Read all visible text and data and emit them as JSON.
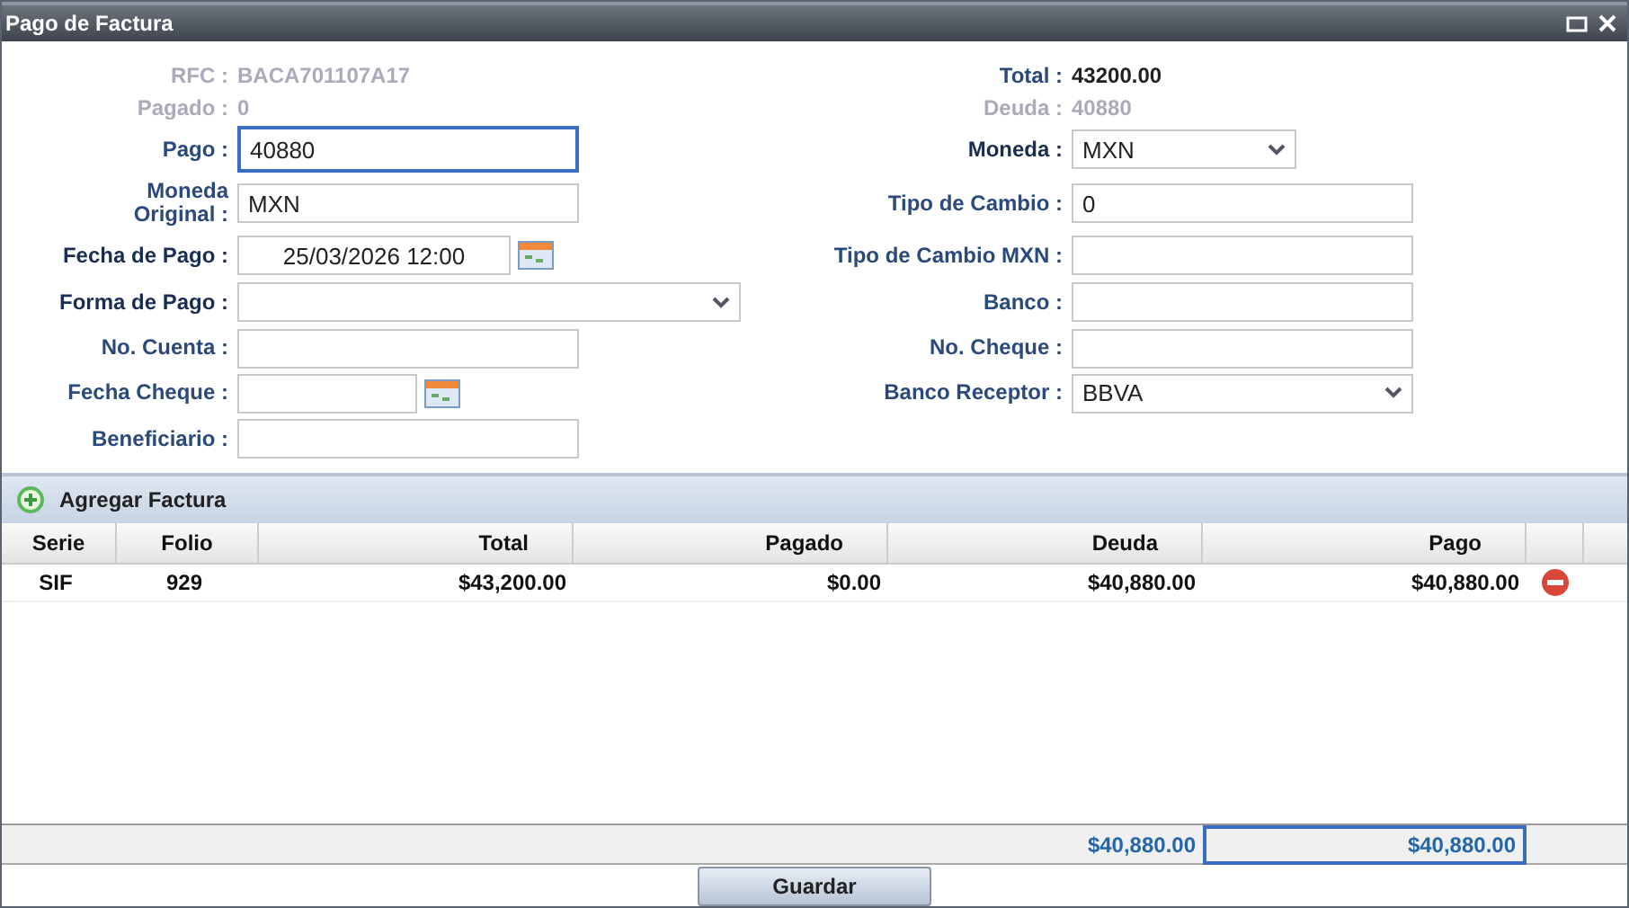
{
  "window": {
    "title": "Pago de Factura"
  },
  "form": {
    "left": [
      {
        "label": "RFC :",
        "kind": "text",
        "value": "BACA701107A17",
        "disabled": true
      },
      {
        "label": "Pagado :",
        "kind": "text",
        "value": "0",
        "disabled": true
      },
      {
        "label": "Pago :",
        "kind": "input",
        "value": "40880",
        "focused": true
      },
      {
        "label": "Moneda\nOriginal :",
        "kind": "input",
        "value": "MXN",
        "focused": false
      },
      {
        "label": "Fecha de Pago :",
        "kind": "date",
        "value": "25/03/2026 12:00",
        "required": true
      },
      {
        "label": "Forma de Pago :",
        "kind": "select",
        "required": true
      },
      {
        "label": "No. Cuenta :",
        "kind": "input",
        "focused": false
      },
      {
        "label": "Fecha Cheque :",
        "kind": "date",
        "required": false
      },
      {
        "label": "Beneficiario :",
        "kind": "input",
        "focused": false
      }
    ],
    "right": [
      {
        "label": "Total :",
        "kind": "text",
        "value": "43200.00",
        "disabled": false
      },
      {
        "label": "Deuda :",
        "kind": "text",
        "value": "40880",
        "disabled": true
      },
      {
        "label": "Moneda :",
        "kind": "select",
        "value": "MXN",
        "required": true
      },
      {
        "label": "Tipo de Cambio :",
        "kind": "input",
        "value": "0",
        "focused": false
      },
      {
        "label": "Tipo de Cambio MXN :",
        "kind": "input",
        "focused": false
      },
      {
        "label": "Banco :",
        "kind": "input",
        "focused": false
      },
      {
        "label": "No. Cheque :",
        "kind": "input",
        "focused": false
      },
      {
        "label": "Banco Receptor :",
        "kind": "select",
        "value": "BBVA",
        "required": false
      }
    ]
  },
  "toolbar": {
    "add_button": "Agregar Factura"
  },
  "table": {
    "columns": [
      "Serie",
      "Folio",
      "Total",
      "Pagado",
      "Deuda",
      "Pago"
    ],
    "rows": [
      {
        "cells": [
          "SIF",
          "929",
          "$43,200.00",
          "$0.00",
          "$40,880.00",
          "$40,880.00"
        ]
      }
    ],
    "totals": [
      {
        "value": "$40,880.00",
        "focused": false
      },
      {
        "value": "$40,880.00",
        "focused": true
      }
    ]
  },
  "save_button": "Guardar"
}
